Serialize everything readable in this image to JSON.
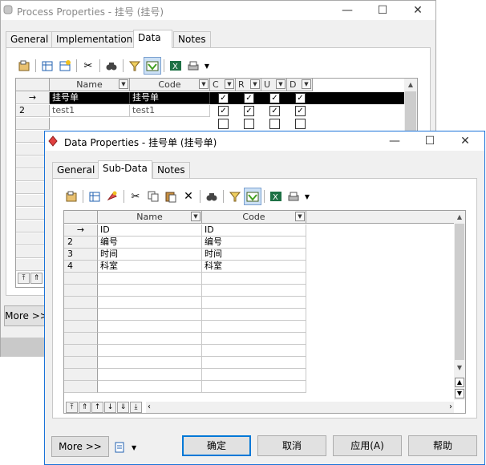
{
  "back_window": {
    "title": "Process Properties - 挂号 (挂号)",
    "tabs": [
      "General",
      "Implementation",
      "Data",
      "Notes"
    ],
    "active_tab": "Data",
    "columns": [
      "Name",
      "Code",
      "C",
      "R",
      "U",
      "D"
    ],
    "rows": [
      {
        "header": "→",
        "name": "挂号单",
        "code": "挂号单"
      },
      {
        "header": "2",
        "name": "test1",
        "code": "test1"
      }
    ],
    "more_label": "More >>"
  },
  "front_window": {
    "title": "Data Properties - 挂号单 (挂号单)",
    "tabs": [
      "General",
      "Sub-Data",
      "Notes"
    ],
    "active_tab": "Sub-Data",
    "columns": [
      "Name",
      "Code"
    ],
    "rows": [
      {
        "header": "→",
        "name": "ID",
        "code": "ID"
      },
      {
        "header": "2",
        "name": "编号",
        "code": "编号"
      },
      {
        "header": "3",
        "name": "时间",
        "code": "时间"
      },
      {
        "header": "4",
        "name": "科室",
        "code": "科室"
      }
    ],
    "buttons": {
      "more": "More >>",
      "ok": "确定",
      "cancel": "取消",
      "apply": "应用(A)",
      "help": "帮助"
    }
  },
  "colors": {
    "active_border": "#1a73d9",
    "selected_row": "#000000",
    "excel_green": "#1e7145"
  }
}
